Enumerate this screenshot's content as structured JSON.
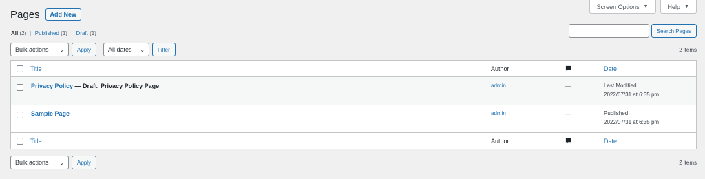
{
  "screen_meta": {
    "screen_options": "Screen Options",
    "help": "Help"
  },
  "header": {
    "title": "Pages",
    "add_new": "Add New"
  },
  "views": {
    "all_label": "All",
    "all_count": "(2)",
    "published_label": "Published",
    "published_count": "(1)",
    "draft_label": "Draft",
    "draft_count": "(1)",
    "separator": "|"
  },
  "search": {
    "value": "",
    "button": "Search Pages"
  },
  "tablenav_top": {
    "bulk_actions": "Bulk actions",
    "apply": "Apply",
    "dates": "All dates",
    "filter": "Filter",
    "count": "2 items"
  },
  "table": {
    "columns": {
      "title": "Title",
      "author": "Author",
      "date": "Date"
    },
    "rows": [
      {
        "title": "Privacy Policy",
        "state": " — Draft, Privacy Policy Page",
        "author": "admin",
        "comments": "—",
        "date_status": "Last Modified",
        "date_value": "2022/07/31 at 6:35 pm"
      },
      {
        "title": "Sample Page",
        "state": "",
        "author": "admin",
        "comments": "—",
        "date_status": "Published",
        "date_value": "2022/07/31 at 6:35 pm"
      }
    ]
  },
  "tablenav_bottom": {
    "bulk_actions": "Bulk actions",
    "apply": "Apply",
    "count": "2 items"
  },
  "icons": {
    "caret": "triangle-down",
    "comment": "speech-bubble"
  },
  "colors": {
    "link": "#2271b1",
    "background": "#f0f0f1"
  }
}
